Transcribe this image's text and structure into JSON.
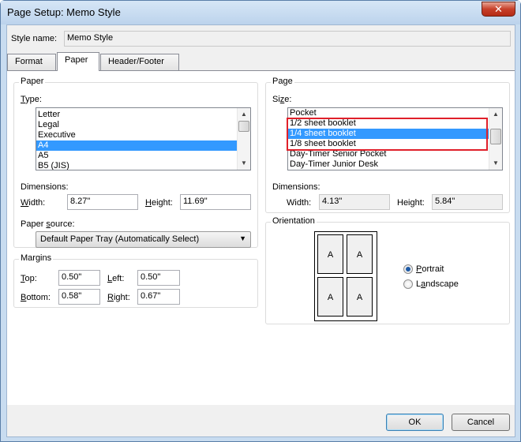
{
  "window": {
    "title": "Page Setup: Memo Style",
    "close_glyph": "✕"
  },
  "style_name": {
    "label": "Style name:",
    "value": "Memo Style"
  },
  "tabs": [
    {
      "label": "Format"
    },
    {
      "label": "Paper"
    },
    {
      "label": "Header/Footer"
    }
  ],
  "paper": {
    "group_title": "Paper",
    "type_label": "Type:",
    "types": [
      "Letter",
      "Legal",
      "Executive",
      "A4",
      "A5",
      "B5 (JIS)"
    ],
    "selected_type": "A4",
    "dimensions_label": "Dimensions:",
    "width_label": "Width:",
    "width_value": "8.27\"",
    "height_label": "Height:",
    "height_value": "11.69\"",
    "source_label": "Paper source:",
    "source_value": "Default Paper Tray (Automatically Select)"
  },
  "margins": {
    "group_title": "Margins",
    "top_label": "Top:",
    "top_value": "0.50\"",
    "left_label": "Left:",
    "left_value": "0.50\"",
    "bottom_label": "Bottom:",
    "bottom_value": "0.58\"",
    "right_label": "Right:",
    "right_value": "0.67\""
  },
  "page": {
    "group_title": "Page",
    "size_label": "Size:",
    "sizes": [
      "Pocket",
      "1/2 sheet booklet",
      "1/4 sheet booklet",
      "1/8 sheet booklet",
      "Day-Timer Senior Pocket",
      "Day-Timer Junior Desk"
    ],
    "selected_size": "1/4 sheet booklet",
    "dimensions_label": "Dimensions:",
    "width_label": "Width:",
    "width_value": "4.13\"",
    "height_label": "Height:",
    "height_value": "5.84\"",
    "highlight_color": "#e0202a"
  },
  "orientation": {
    "group_title": "Orientation",
    "preview_letters": [
      "A",
      "A",
      "A",
      "A"
    ],
    "portrait_label": "Portrait",
    "landscape_label": "Landscape",
    "selected": "Portrait"
  },
  "buttons": {
    "ok": "OK",
    "cancel": "Cancel"
  }
}
